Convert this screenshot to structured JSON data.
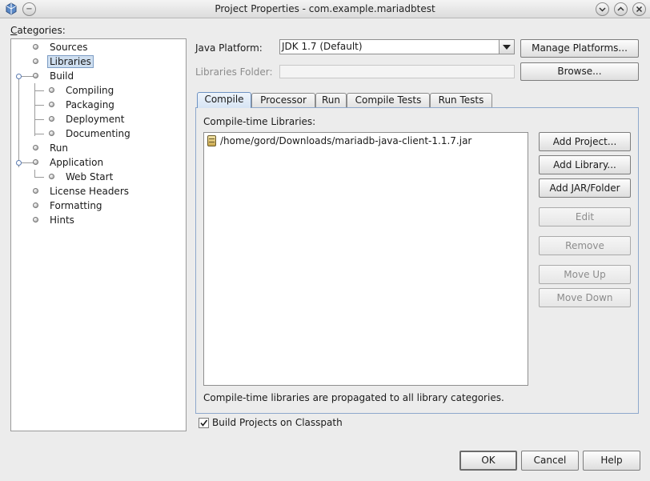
{
  "window": {
    "title": "Project Properties - com.example.mariadbtest",
    "buttons": [
      "minimize",
      "maximize",
      "close"
    ]
  },
  "categories": {
    "label": "Categories:",
    "items": [
      {
        "label": "Sources",
        "level": 0
      },
      {
        "label": "Libraries",
        "level": 0,
        "selected": true
      },
      {
        "label": "Build",
        "level": 0
      },
      {
        "label": "Compiling",
        "level": 1
      },
      {
        "label": "Packaging",
        "level": 1
      },
      {
        "label": "Deployment",
        "level": 1
      },
      {
        "label": "Documenting",
        "level": 1
      },
      {
        "label": "Run",
        "level": 0
      },
      {
        "label": "Application",
        "level": 0
      },
      {
        "label": "Web Start",
        "level": 1
      },
      {
        "label": "License Headers",
        "level": 0
      },
      {
        "label": "Formatting",
        "level": 0
      },
      {
        "label": "Hints",
        "level": 0
      }
    ]
  },
  "java_platform": {
    "label": "Java Platform:",
    "value": "JDK 1.7 (Default)",
    "manage_button": "Manage Platforms..."
  },
  "libraries_folder": {
    "label": "Libraries Folder:",
    "value": "",
    "browse_button": "Browse..."
  },
  "tabs": [
    {
      "label": "Compile",
      "active": true
    },
    {
      "label": "Processor"
    },
    {
      "label": "Run"
    },
    {
      "label": "Compile Tests"
    },
    {
      "label": "Run Tests"
    }
  ],
  "compile": {
    "list_label": "Compile-time Libraries:",
    "libraries": [
      "/home/gord/Downloads/mariadb-java-client-1.1.7.jar"
    ],
    "buttons": {
      "add_project": "Add Project...",
      "add_library": "Add Library...",
      "add_jar": "Add JAR/Folder",
      "edit": "Edit",
      "remove": "Remove",
      "move_up": "Move Up",
      "move_down": "Move Down"
    },
    "note": "Compile-time libraries are propagated to all library categories."
  },
  "build_on_classpath": {
    "label": "Build Projects on Classpath",
    "checked": true
  },
  "dialog_buttons": {
    "ok": "OK",
    "cancel": "Cancel",
    "help": "Help"
  },
  "colors": {
    "selection_bg": "#cfdff0",
    "tab_active_border": "#6e92c2",
    "window_bg": "#ececec"
  }
}
